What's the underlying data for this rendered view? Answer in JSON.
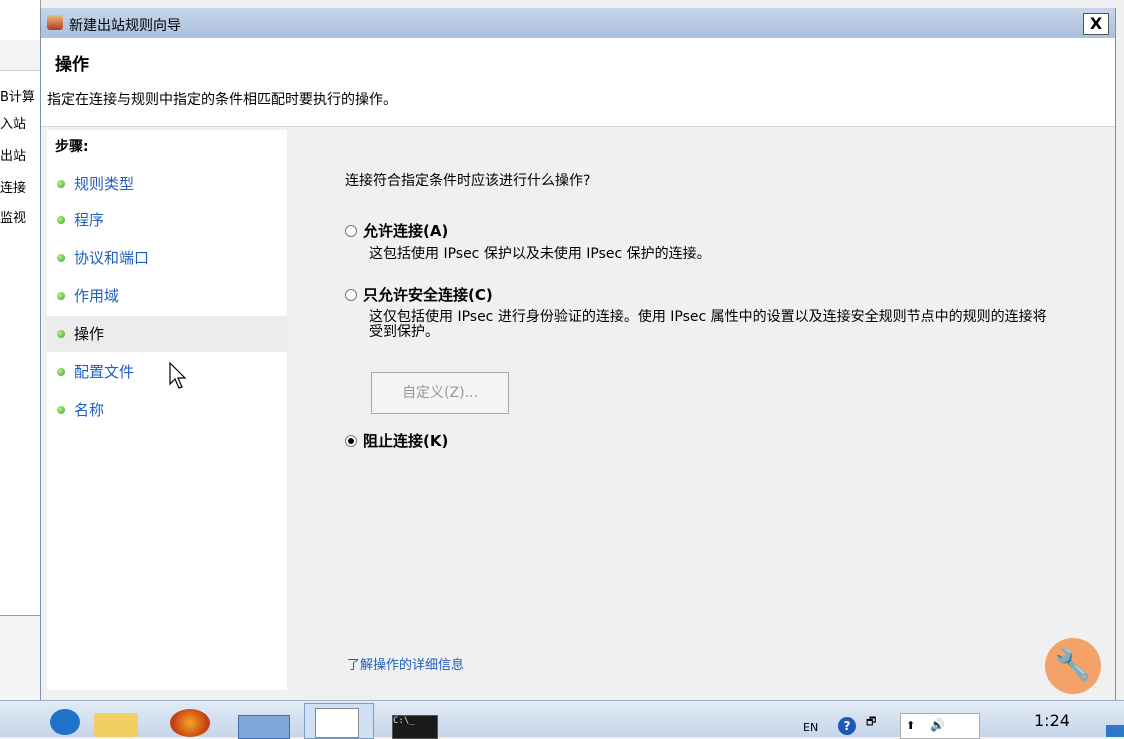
{
  "background": {
    "items": [
      "B计算",
      "入站",
      "出站",
      "连接",
      "监视"
    ]
  },
  "dialog": {
    "title": "新建出站规则向导",
    "close_glyph": "X",
    "header_title": "操作",
    "header_desc": "指定在连接与规则中指定的条件相匹配时要执行的操作。"
  },
  "steps": {
    "title": "步骤:",
    "items": [
      {
        "label": "规则类型"
      },
      {
        "label": "程序"
      },
      {
        "label": "协议和端口"
      },
      {
        "label": "作用域"
      },
      {
        "label": "操作"
      },
      {
        "label": "配置文件"
      },
      {
        "label": "名称"
      }
    ],
    "active_index": 4
  },
  "content": {
    "question": "连接符合指定条件时应该进行什么操作?",
    "options": [
      {
        "label": "允许连接(A)",
        "desc": "这包括使用 IPsec 保护以及未使用 IPsec 保护的连接。",
        "checked": false
      },
      {
        "label": "只允许安全连接(C)",
        "desc": "这仅包括使用 IPsec 进行身份验证的连接。使用 IPsec 属性中的设置以及连接安全规则节点中的规则的连接将受到保护。",
        "checked": false
      },
      {
        "label": "阻止连接(K)",
        "desc": "",
        "checked": true
      }
    ],
    "custom_button": "自定义(Z)...",
    "learn_link": "了解操作的详细信息"
  },
  "taskbar": {
    "lang": "EN",
    "time": "1:24",
    "icons": [
      "ie-icon",
      "folder-icon",
      "firefox-icon",
      "app-icon",
      "firewall-icon",
      "cmd-icon"
    ],
    "cmd_text": "C:\\_"
  }
}
